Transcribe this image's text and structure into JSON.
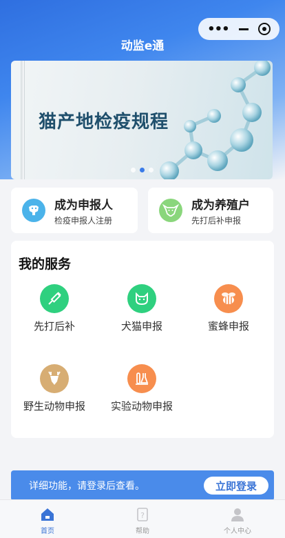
{
  "app": {
    "title": "动监e通"
  },
  "capsule": {
    "more": "•••",
    "minimize": "—",
    "close": "◎"
  },
  "banner": {
    "title": "猫产地检疫规程",
    "slides": 3,
    "active_slide": 1
  },
  "roles": [
    {
      "title": "成为申报人",
      "subtitle": "检疫申报人注册",
      "icon": "dog-icon",
      "color": "#4bb3ea"
    },
    {
      "title": "成为养殖户",
      "subtitle": "先打后补申报",
      "icon": "cow-icon",
      "color": "#8ad67c"
    }
  ],
  "services": {
    "title": "我的服务",
    "items": [
      {
        "label": "先打后补",
        "icon": "syringe-icon",
        "color": "#2fd07f"
      },
      {
        "label": "犬猫申报",
        "icon": "cat-icon",
        "color": "#2fd07f"
      },
      {
        "label": "蜜蜂申报",
        "icon": "bee-icon",
        "color": "#f78e4e"
      },
      {
        "label": "野生动物申报",
        "icon": "deer-icon",
        "color": "#d7ad73"
      },
      {
        "label": "实验动物申报",
        "icon": "flask-icon",
        "color": "#f78e4e"
      }
    ]
  },
  "login": {
    "text": "详细功能，请登录后查看。",
    "button": "立即登录"
  },
  "tabbar": {
    "items": [
      {
        "label": "首页",
        "icon": "home-icon",
        "active": true
      },
      {
        "label": "帮助",
        "icon": "help-icon",
        "active": false
      },
      {
        "label": "个人中心",
        "icon": "user-icon",
        "active": false
      }
    ]
  }
}
